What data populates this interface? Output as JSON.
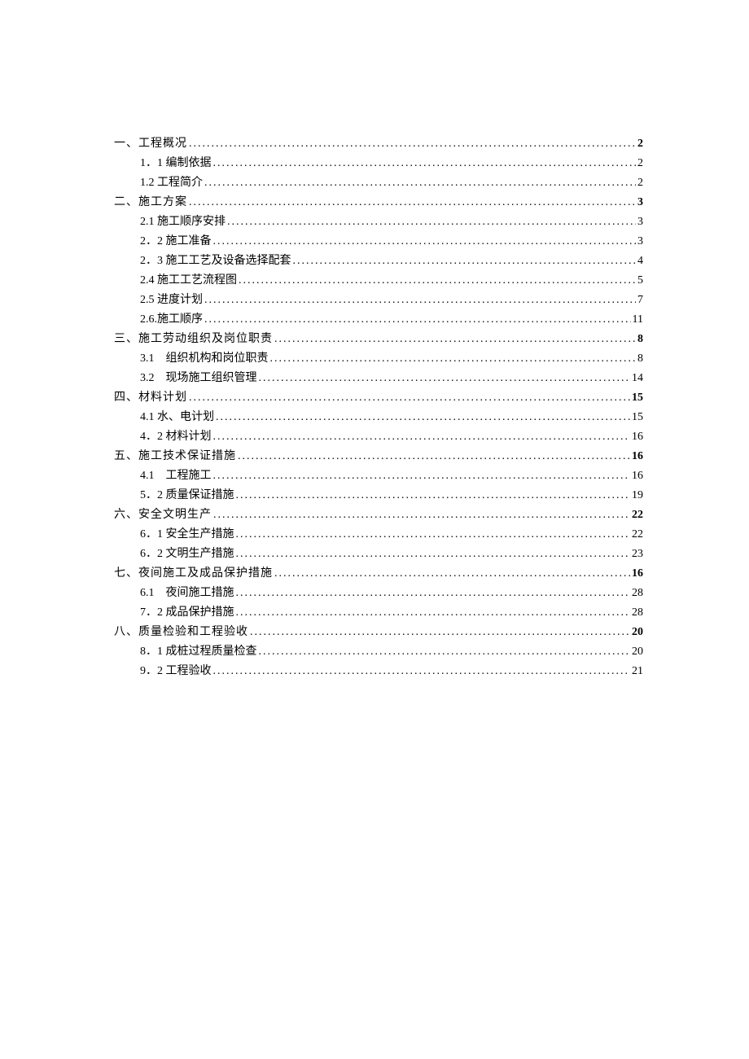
{
  "toc": [
    {
      "level": 1,
      "title": "一、工程概况",
      "page": "2",
      "boldPage": true
    },
    {
      "level": 2,
      "title": "1．1 编制依据",
      "page": "2"
    },
    {
      "level": 2,
      "title": "1.2 工程简介",
      "page": "2"
    },
    {
      "level": 1,
      "title": "二、施工方案",
      "page": "3",
      "boldPage": true
    },
    {
      "level": 2,
      "title": "2.1 施工顺序安排",
      "page": "3"
    },
    {
      "level": 2,
      "title": "2．2 施工准备",
      "page": "3"
    },
    {
      "level": 2,
      "title": "2．3 施工工艺及设备选择配套",
      "page": "4"
    },
    {
      "level": 2,
      "title": "2.4 施工工艺流程图",
      "page": "5"
    },
    {
      "level": 2,
      "title": "2.5 进度计划",
      "page": "7"
    },
    {
      "level": 2,
      "title": "2.6.施工顺序",
      "page": "11"
    },
    {
      "level": 1,
      "title": "三、施工劳动组织及岗位职责",
      "page": "8",
      "boldPage": true
    },
    {
      "level": 2,
      "title": "3.1　组织机构和岗位职责",
      "page": "8"
    },
    {
      "level": 2,
      "title": "3.2　现场施工组织管理",
      "page": "14"
    },
    {
      "level": 1,
      "title": "四、材料计划",
      "page": "15",
      "boldPage": true
    },
    {
      "level": 2,
      "title": "4.1 水、电计划",
      "page": "15"
    },
    {
      "level": 2,
      "title": "4．2 材料计划",
      "page": "16"
    },
    {
      "level": 1,
      "title": "五、施工技术保证措施",
      "page": "16",
      "boldPage": true
    },
    {
      "level": 2,
      "title": "4.1　工程施工",
      "page": "16"
    },
    {
      "level": 2,
      "title": "5．2 质量保证措施",
      "page": "19"
    },
    {
      "level": 1,
      "title": "六、安全文明生产",
      "page": "22",
      "boldPage": true
    },
    {
      "level": 2,
      "title": "6．1 安全生产措施",
      "page": "22"
    },
    {
      "level": 2,
      "title": "6．2 文明生产措施",
      "page": "23"
    },
    {
      "level": 1,
      "title": "七、夜间施工及成品保护措施",
      "page": "16",
      "boldPage": true
    },
    {
      "level": 2,
      "title": "6.1　夜间施工措施",
      "page": "28"
    },
    {
      "level": 2,
      "title": "7．2 成品保护措施",
      "page": "28"
    },
    {
      "level": 1,
      "title": "八、质量检验和工程验收",
      "page": "20",
      "boldPage": true
    },
    {
      "level": 2,
      "title": "8．1 成桩过程质量检查",
      "page": "20"
    },
    {
      "level": 2,
      "title": "9．2 工程验收",
      "page": "21"
    }
  ]
}
